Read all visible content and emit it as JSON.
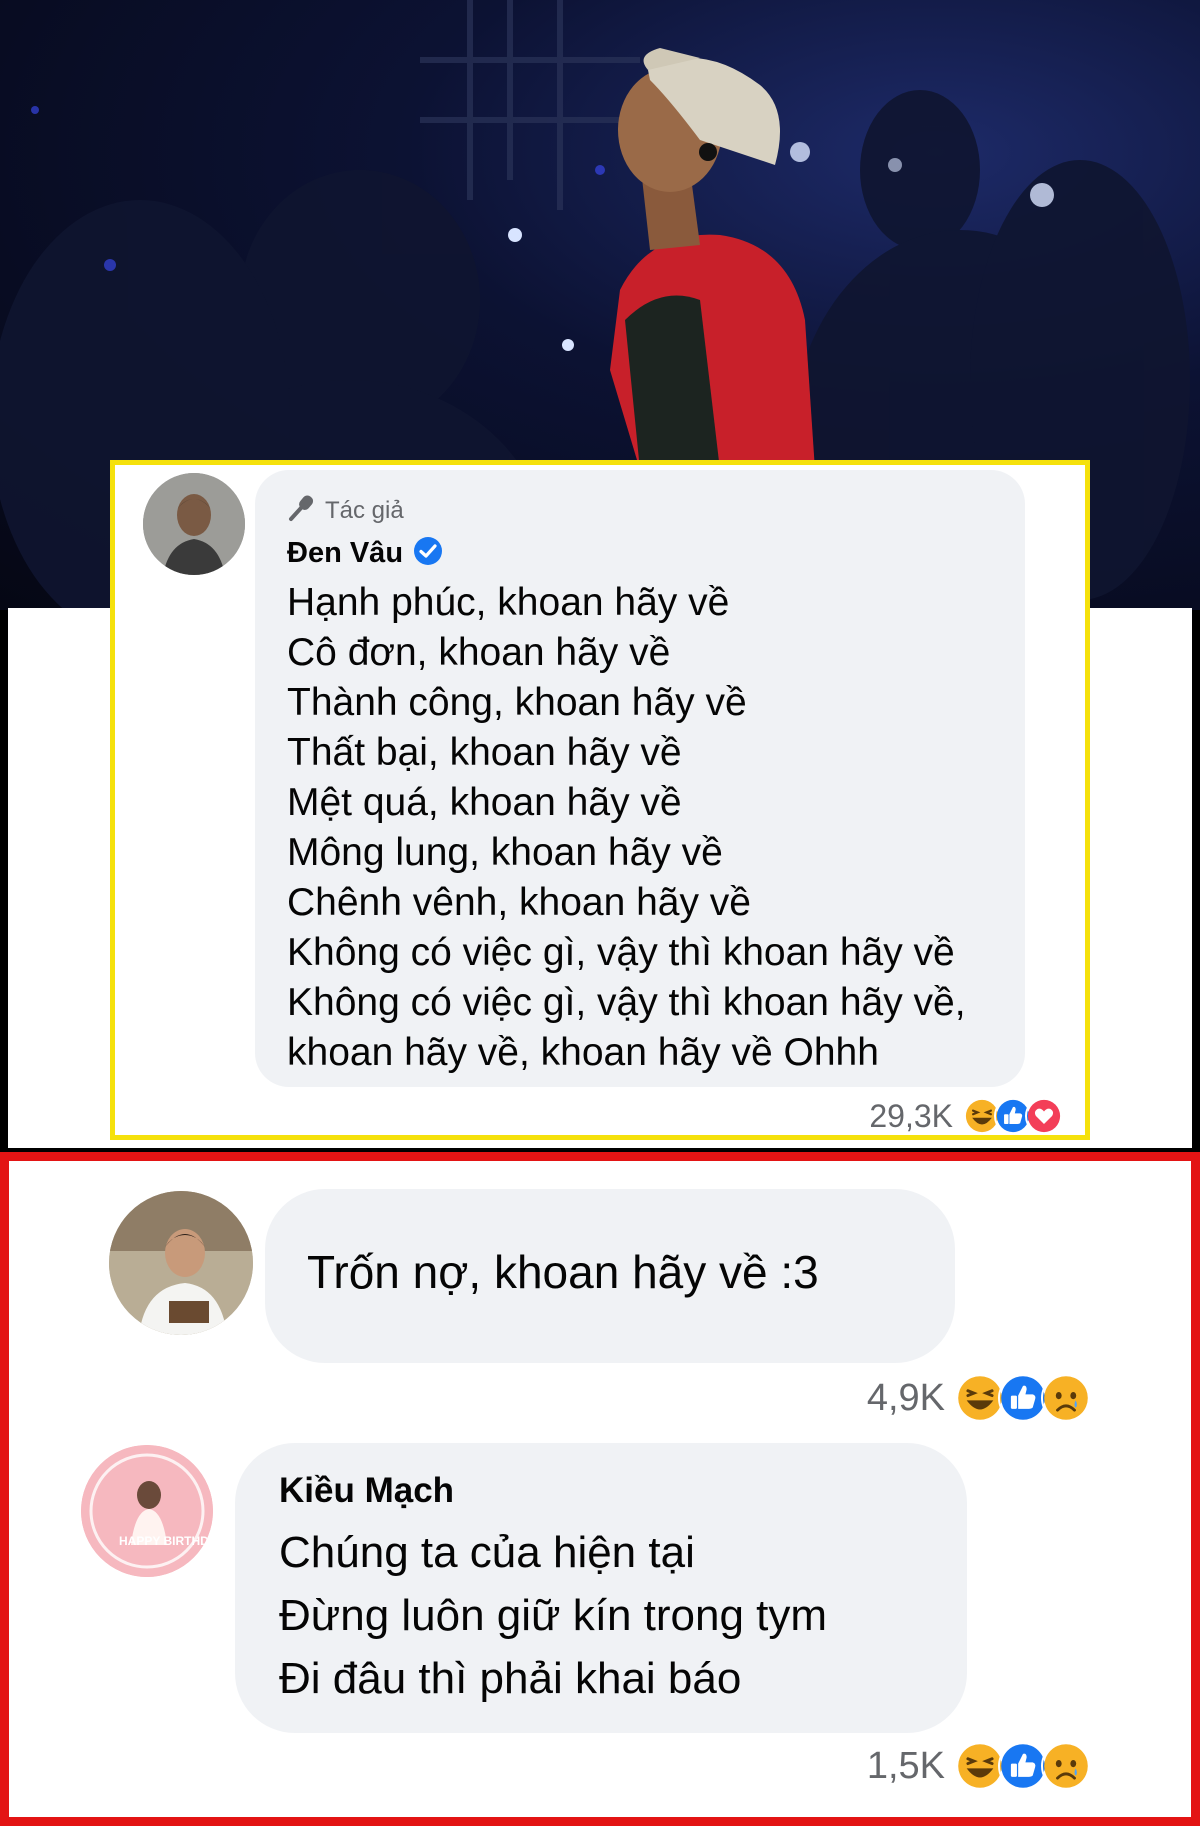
{
  "author_comment": {
    "badge_label": "Tác giả",
    "badge_icon": "microphone-icon",
    "name": "Đen Vâu",
    "verified_icon": "verified-badge-icon",
    "lines": [
      "Hạnh phúc, khoan hãy về",
      "Cô đơn, khoan hãy về",
      "Thành công, khoan hãy về",
      "Thất bại, khoan hãy về",
      "Mệt quá, khoan hãy về",
      "Mông lung, khoan hãy về",
      "Chênh vênh, khoan hãy về",
      "Không có việc gì, vậy thì khoan hãy về",
      "Không có việc gì, vậy thì khoan hãy về,",
      "khoan hãy về, khoan hãy về Ohhh"
    ],
    "reaction_count": "29,3K",
    "reactions": [
      "haha-icon",
      "like-icon",
      "love-icon"
    ]
  },
  "replies": [
    {
      "text": "Trốn nợ, khoan hãy về :3",
      "reaction_count": "4,9K",
      "reactions": [
        "haha-icon",
        "like-icon",
        "sad-icon"
      ]
    },
    {
      "name": "Kiều Mạch",
      "avatar_text": "HAPPY BIRTHDAY",
      "lines": [
        "Chúng ta của hiện tại",
        "Đừng luôn giữ kín trong tym",
        "Đi đâu thì phải khai báo"
      ],
      "reaction_count": "1,5K",
      "reactions": [
        "haha-icon",
        "like-icon",
        "sad-icon"
      ]
    }
  ],
  "colors": {
    "author_frame": "#f5e10c",
    "replies_frame": "#e31414",
    "bubble": "#f0f2f5",
    "like": "#1877f2",
    "love": "#f33e58",
    "haha": "#f7b125"
  }
}
